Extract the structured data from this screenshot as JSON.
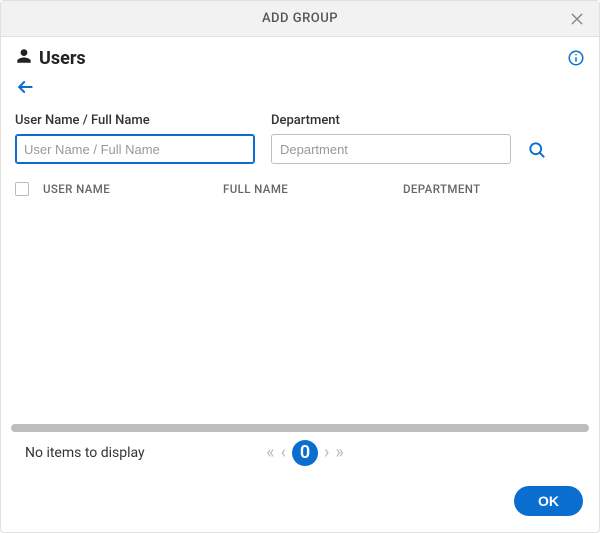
{
  "modal": {
    "title": "ADD GROUP"
  },
  "header": {
    "title": "Users"
  },
  "filters": {
    "username": {
      "label": "User Name / Full Name",
      "placeholder": "User Name / Full Name",
      "value": ""
    },
    "department": {
      "label": "Department",
      "placeholder": "Department",
      "value": ""
    }
  },
  "columns": {
    "username": "USER NAME",
    "fullname": "FULL NAME",
    "department": "DEPARTMENT"
  },
  "pager": {
    "empty_text": "No items to display",
    "page": "0"
  },
  "footer": {
    "ok": "OK"
  }
}
